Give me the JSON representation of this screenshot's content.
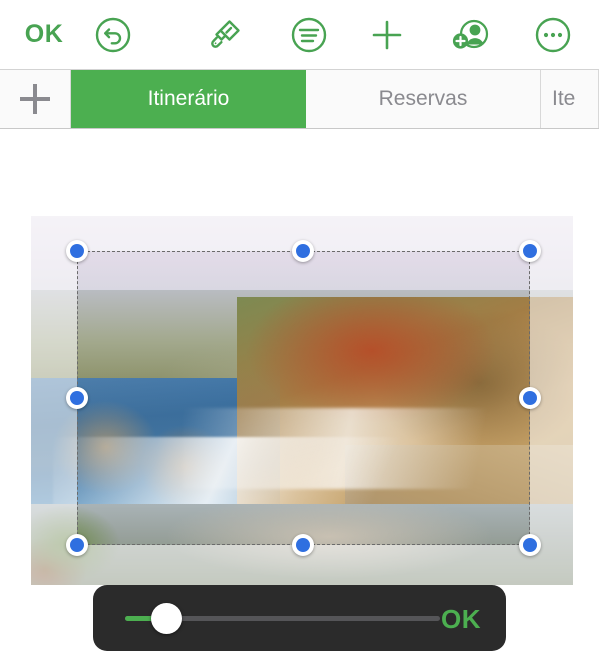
{
  "toolbar": {
    "done_label": "OK",
    "items": [
      {
        "name": "done-button",
        "label": "OK",
        "icon": "text-ok"
      },
      {
        "name": "undo-button",
        "label": "Undo",
        "icon": "undo-circle-icon"
      },
      {
        "name": "format-brush-button",
        "label": "Format",
        "icon": "paintbrush-icon"
      },
      {
        "name": "paragraph-button",
        "label": "Paragraph",
        "icon": "text-lines-circle-icon"
      },
      {
        "name": "insert-button",
        "label": "Insert",
        "icon": "plus-icon"
      },
      {
        "name": "collaborate-button",
        "label": "Collaborate",
        "icon": "add-person-icon"
      },
      {
        "name": "more-button",
        "label": "More",
        "icon": "ellipsis-circle-icon"
      }
    ]
  },
  "tabbar": {
    "add_tab_label": "+",
    "tabs": [
      {
        "label": "Itinerário",
        "active": true
      },
      {
        "label": "Reservas",
        "active": false
      },
      {
        "label": "Ite",
        "active": false
      }
    ]
  },
  "canvas": {
    "image_alt": "Rocky coastline with ocean waves and cliffs",
    "selection": {
      "handles": [
        "top-left-handle",
        "top-center-handle",
        "top-right-handle",
        "middle-left-handle",
        "middle-right-handle",
        "bottom-left-handle",
        "bottom-center-handle",
        "bottom-right-handle"
      ]
    }
  },
  "slider_bar": {
    "ok_label": "OK",
    "slider_value": 8,
    "slider_min": 0,
    "slider_max": 100
  },
  "colors": {
    "accent_green": "#4caf50",
    "toolbar_green": "#48a352",
    "handle_blue": "#2f6fe0",
    "bar_dark": "#2b2b2b",
    "tab_inactive_text": "#8a8a8f"
  }
}
